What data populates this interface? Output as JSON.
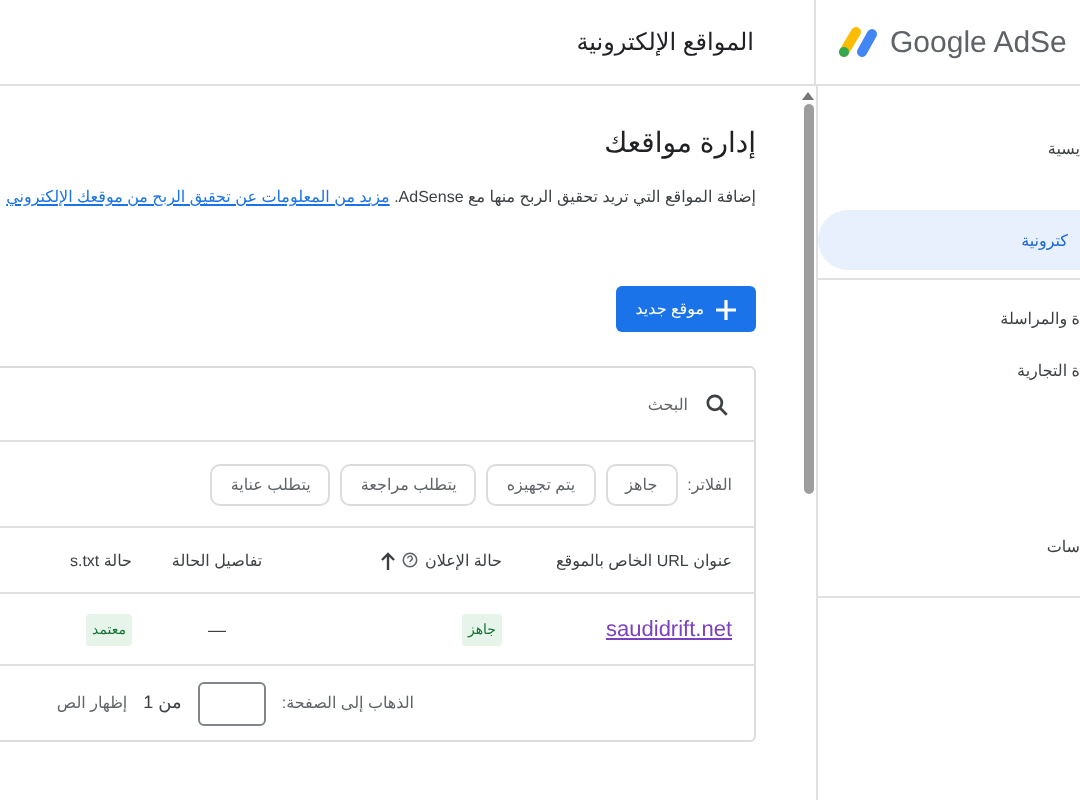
{
  "header": {
    "product": "Google AdSe",
    "page_title": "المواقع الإلكترونية"
  },
  "main": {
    "title": "إدارة مواقعك",
    "description": "إضافة المواقع التي تريد تحقيق الربح منها مع AdSense.",
    "learn_more_link": "مزيد من المعلومات عن تحقيق الربح من موقعك الإلكتروني",
    "new_site_button": "موقع جديد"
  },
  "sites_table": {
    "search_placeholder": "البحث",
    "filters_label": "الفلاتر:",
    "filters": [
      "جاهز",
      "يتم تجهيزه",
      "يتطلب مراجعة",
      "يتطلب عناية"
    ],
    "columns": [
      "عنوان URL الخاص بالموقع",
      "حالة الإعلان",
      "تفاصيل الحالة",
      "حالة s.txt"
    ],
    "rows": [
      {
        "url": "saudidrift.net",
        "ad_status": "جاهز",
        "status_details": "—",
        "ads_txt_status": "معتمد"
      }
    ],
    "pagination": {
      "goto_label": "الذهاب إلى الصفحة:",
      "of_label": "من 1",
      "rows_label": "إظهار الص"
    }
  },
  "sidebar": {
    "items": [
      {
        "label": "يسية",
        "selected": false
      },
      {
        "label": "كترونية",
        "selected": true
      },
      {
        "label": "ة والمراسلة",
        "selected": false
      },
      {
        "label": "ة التجارية",
        "selected": false
      },
      {
        "label": "سات",
        "selected": false
      }
    ]
  }
}
